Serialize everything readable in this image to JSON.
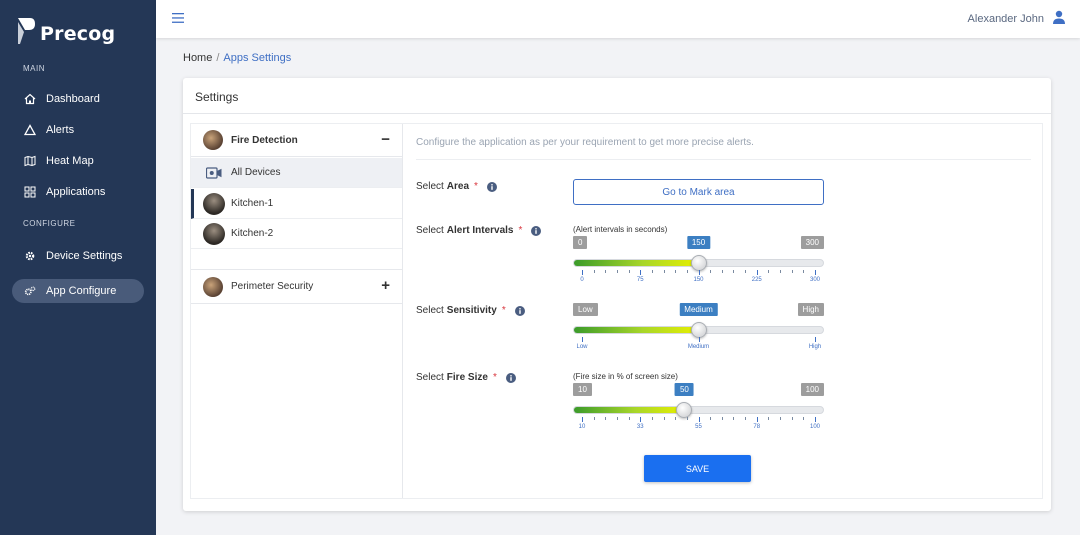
{
  "brand": {
    "name": "Precog"
  },
  "sidebar": {
    "main_label": "MAIN",
    "configure_label": "CONFIGURE",
    "items": [
      {
        "label": "Dashboard",
        "icon": "home-icon"
      },
      {
        "label": "Alerts",
        "icon": "alert-icon"
      },
      {
        "label": "Heat Map",
        "icon": "map-icon"
      },
      {
        "label": "Applications",
        "icon": "grid-icon"
      },
      {
        "label": "Device Settings",
        "icon": "gear-icon"
      },
      {
        "label": "App Configure",
        "icon": "gears-icon",
        "active": true
      }
    ]
  },
  "topbar": {
    "user_name": "Alexander John"
  },
  "breadcrumb": {
    "home": "Home",
    "separator": "/",
    "current": "Apps Settings"
  },
  "settings": {
    "title": "Settings",
    "groups": [
      {
        "label": "Fire Detection",
        "toggle": "−",
        "expanded": true
      },
      {
        "label": "Perimeter Security",
        "toggle": "+",
        "expanded": false
      }
    ],
    "devices": [
      {
        "label": "All Devices"
      },
      {
        "label": "Kitchen-1",
        "selected": true
      },
      {
        "label": "Kitchen-2"
      }
    ],
    "description": "Configure the application as per your requirement to get more precise alerts.",
    "area": {
      "label_prefix": "Select",
      "label_bold": "Area",
      "required": "*",
      "button": "Go to Mark area"
    },
    "alert_intervals": {
      "label_prefix": "Select",
      "label_bold": "Alert Intervals",
      "required": "*",
      "hint": "(Alert intervals in seconds)",
      "min_label": "0",
      "max_label": "300",
      "value_label": "150",
      "value_fraction": 0.5,
      "tick_labels": [
        "0",
        "75",
        "150",
        "225",
        "300"
      ]
    },
    "sensitivity": {
      "label_prefix": "Select",
      "label_bold": "Sensitivity",
      "required": "*",
      "min_label": "Low",
      "max_label": "High",
      "value_label": "Medium",
      "value_fraction": 0.5,
      "tick_labels": [
        "Low",
        "Medium",
        "High"
      ]
    },
    "fire_size": {
      "label_prefix": "Select",
      "label_bold": "Fire Size",
      "required": "*",
      "hint": "(Fire size in % of screen size)",
      "min_label": "10",
      "max_label": "100",
      "value_label": "50",
      "value_fraction": 0.444,
      "tick_labels": [
        "10",
        "33",
        "55",
        "78",
        "100"
      ]
    },
    "save_label": "SAVE"
  },
  "colors": {
    "sidebar": "#243756",
    "accent": "#3f6fc4",
    "save": "#1a6ff0",
    "required": "#d9363e"
  }
}
